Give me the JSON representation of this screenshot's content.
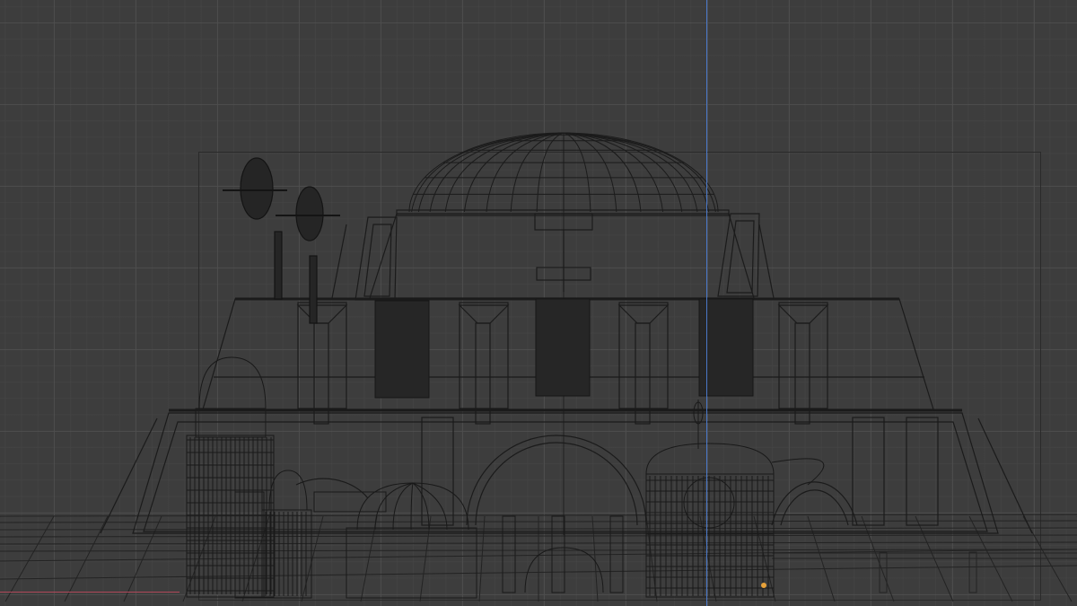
{
  "viewport": {
    "colors": {
      "background": "#3d3d3d",
      "grid_major": "#4e4e4e",
      "wire": "#1b1b1b",
      "axis_y": "#4a78c8",
      "axis_x": "#b0485a",
      "light": "#e8a23a"
    }
  },
  "scene": {
    "objects": [
      "dome",
      "upper-tier",
      "banner",
      "lower-tier",
      "arch",
      "satellite-dish",
      "tower",
      "small-dome",
      "ground-grid",
      "light-source"
    ]
  }
}
